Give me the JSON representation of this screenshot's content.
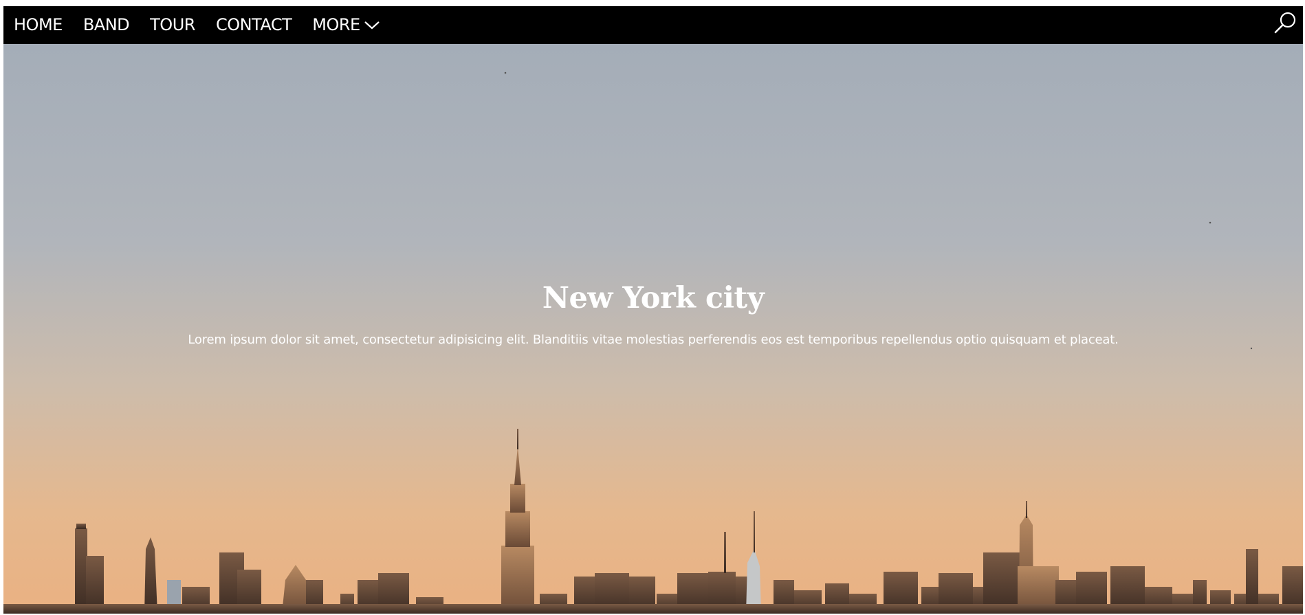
{
  "nav": {
    "items": [
      {
        "label": "HOME"
      },
      {
        "label": "BAND"
      },
      {
        "label": "TOUR"
      },
      {
        "label": "CONTACT"
      }
    ],
    "more_label": "MORE",
    "more_icon": "chevron-down-icon",
    "search_icon": "search-icon"
  },
  "hero": {
    "title": "New York city",
    "text": "Lorem ipsum dolor sit amet, consectetur adipisicing elit. Blanditiis vitae molestias perferendis eos est temporibus repellendus optio quisquam et placeat."
  },
  "colors": {
    "nav_bg": "#000000",
    "nav_text": "#ffffff",
    "sky_top": "#a4adb8",
    "sky_bottom": "#e9b585"
  }
}
